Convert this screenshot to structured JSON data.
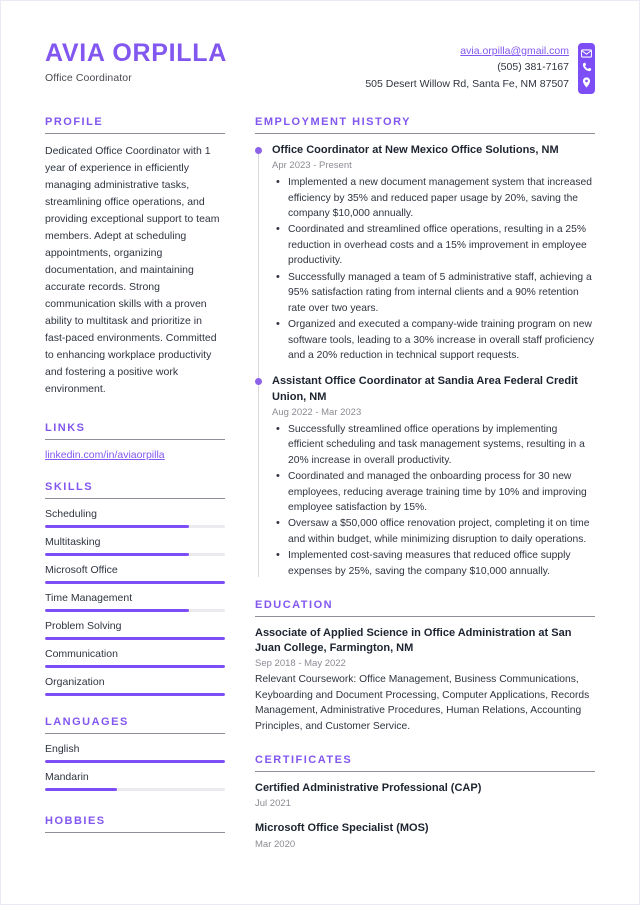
{
  "header": {
    "name": "AVIA ORPILLA",
    "job_title": "Office Coordinator",
    "email": "avia.orpilla@gmail.com",
    "phone": "(505) 381-7167",
    "address": "505 Desert Willow Rd, Santa Fe, NM 87507",
    "icons": [
      "envelope-icon",
      "phone-icon",
      "location-pin-icon"
    ]
  },
  "colors": {
    "accent": "#8257f0",
    "accent_bar": "#7d4df5",
    "dot": "#8c63e8",
    "text": "#2f3440",
    "muted": "#8b8b93",
    "track": "#ebebef",
    "rule": "#8e8e98"
  },
  "sections": {
    "profile_heading": "PROFILE",
    "links_heading": "LINKS",
    "skills_heading": "SKILLS",
    "languages_heading": "LANGUAGES",
    "hobbies_heading": "HOBBIES",
    "employment_heading": "EMPLOYMENT HISTORY",
    "education_heading": "EDUCATION",
    "certificates_heading": "CERTIFICATES"
  },
  "profile": {
    "text": "Dedicated Office Coordinator with 1 year of experience in efficiently managing administrative tasks, streamlining office operations, and providing exceptional support to team members. Adept at scheduling appointments, organizing documentation, and maintaining accurate records. Strong communication skills with a proven ability to multitask and prioritize in fast-paced environments. Committed to enhancing workplace productivity and fostering a positive work environment."
  },
  "links": [
    {
      "label": "linkedin.com/in/aviaorpilla"
    }
  ],
  "skills": [
    {
      "label": "Scheduling",
      "level": 80
    },
    {
      "label": "Multitasking",
      "level": 80
    },
    {
      "label": "Microsoft Office",
      "level": 100
    },
    {
      "label": "Time Management",
      "level": 80
    },
    {
      "label": "Problem Solving",
      "level": 100
    },
    {
      "label": "Communication",
      "level": 100
    },
    {
      "label": "Organization",
      "level": 100
    }
  ],
  "languages": [
    {
      "label": "English",
      "level": 100
    },
    {
      "label": "Mandarin",
      "level": 40
    }
  ],
  "hobbies": [],
  "employment": [
    {
      "title": "Office Coordinator at New Mexico Office Solutions, NM",
      "dates": "Apr 2023 - Present",
      "bullets": [
        "Implemented a new document management system that increased efficiency by 35% and reduced paper usage by 20%, saving the company $10,000 annually.",
        "Coordinated and streamlined office operations, resulting in a 25% reduction in overhead costs and a 15% improvement in employee productivity.",
        "Successfully managed a team of 5 administrative staff, achieving a 95% satisfaction rating from internal clients and a 90% retention rate over two years.",
        "Organized and executed a company-wide training program on new software tools, leading to a 30% increase in overall staff proficiency and a 20% reduction in technical support requests."
      ]
    },
    {
      "title": "Assistant Office Coordinator at Sandia Area Federal Credit Union, NM",
      "dates": "Aug 2022 - Mar 2023",
      "bullets": [
        "Successfully streamlined office operations by implementing efficient scheduling and task management systems, resulting in a 20% increase in overall productivity.",
        "Coordinated and managed the onboarding process for 30 new employees, reducing average training time by 10% and improving employee satisfaction by 15%.",
        "Oversaw a $50,000 office renovation project, completing it on time and within budget, while minimizing disruption to daily operations.",
        "Implemented cost-saving measures that reduced office supply expenses by 25%, saving the company $10,000 annually."
      ]
    }
  ],
  "education": [
    {
      "title": "Associate of Applied Science in Office Administration at San Juan College, Farmington, NM",
      "dates": "Sep 2018 - May 2022",
      "description": "Relevant Coursework: Office Management, Business Communications, Keyboarding and Document Processing, Computer Applications, Records Management, Administrative Procedures, Human Relations, Accounting Principles, and Customer Service."
    }
  ],
  "certificates": [
    {
      "title": "Certified Administrative Professional (CAP)",
      "dates": "Jul 2021"
    },
    {
      "title": "Microsoft Office Specialist (MOS)",
      "dates": "Mar 2020"
    }
  ]
}
